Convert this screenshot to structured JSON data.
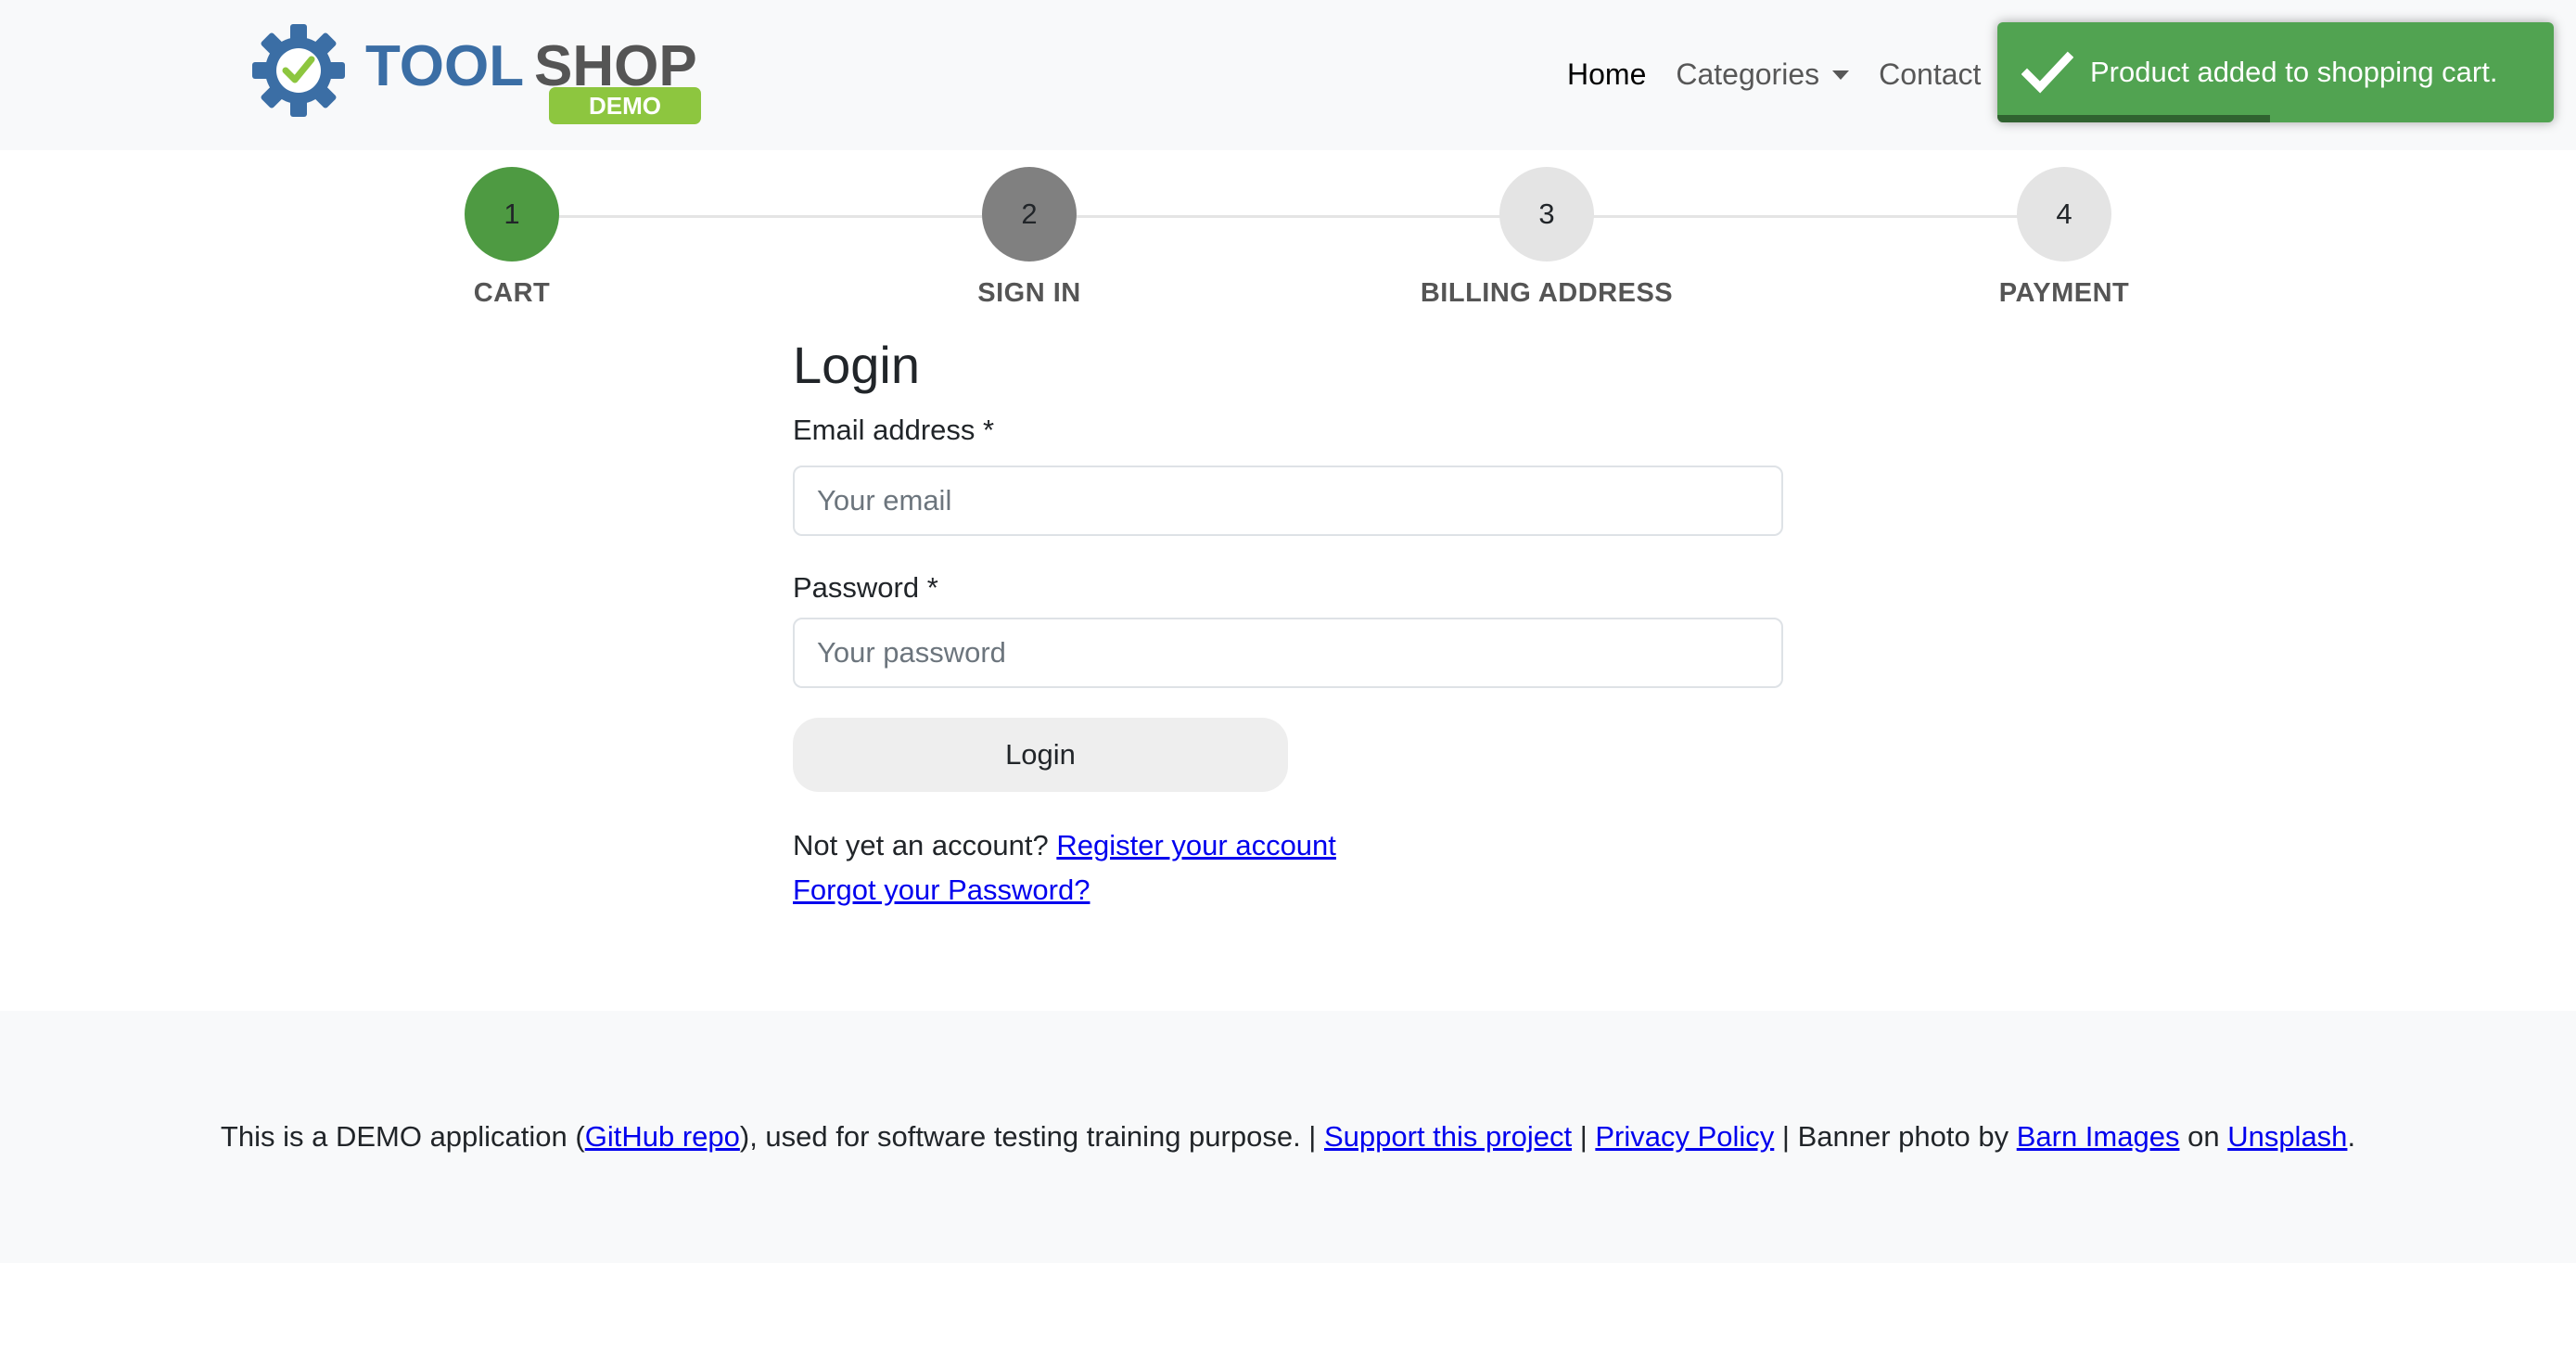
{
  "brand": {
    "name_part1": "TOOL",
    "name_part2": "SHOP",
    "badge": "DEMO",
    "colors": {
      "gear": "#3b6ea5",
      "check": "#8dc63f",
      "tool": "#3b6ea5",
      "shop": "#555555",
      "badge_bg": "#8dc63f"
    }
  },
  "nav": {
    "home": "Home",
    "categories": "Categories",
    "contact": "Contact"
  },
  "toast": {
    "icon": "checkmark-icon",
    "message": "Product added to shopping cart.",
    "progress": 0.49,
    "color": "#51a351"
  },
  "steps": [
    {
      "number": "1",
      "label": "CART",
      "state": "completed",
      "color": "#4e9a42"
    },
    {
      "number": "2",
      "label": "SIGN IN",
      "state": "current",
      "color": "#808080"
    },
    {
      "number": "3",
      "label": "BILLING ADDRESS",
      "state": "pending",
      "color": "#e4e4e4"
    },
    {
      "number": "4",
      "label": "PAYMENT",
      "state": "pending",
      "color": "#e4e4e4"
    }
  ],
  "login": {
    "title": "Login",
    "email_label": "Email address *",
    "email_placeholder": "Your email",
    "email_value": "",
    "password_label": "Password *",
    "password_placeholder": "Your password",
    "password_value": "",
    "button": "Login",
    "no_account_text": "Not yet an account?",
    "register_link": "Register your account",
    "forgot_link": "Forgot your Password?"
  },
  "footer": {
    "t1": "This is a DEMO application (",
    "github_link": "GitHub repo",
    "t2": "), used for software testing training purpose. | ",
    "support_link": "Support this project",
    "t3": " | ",
    "privacy_link": "Privacy Policy",
    "t4": " | Banner photo by ",
    "barn_link": "Barn Images",
    "t5": " on ",
    "unsplash_link": "Unsplash",
    "t6": "."
  }
}
